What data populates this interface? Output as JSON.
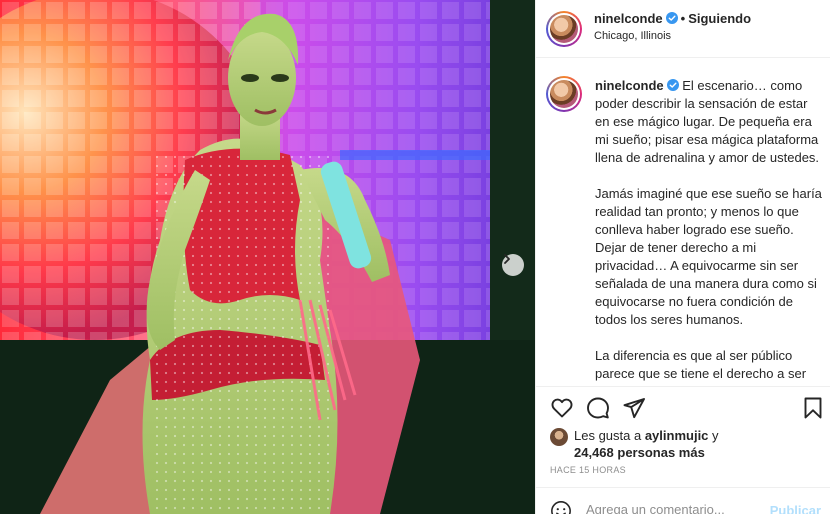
{
  "post": {
    "username": "ninelconde",
    "verified": true,
    "follow_status": "Siguiendo",
    "location": "Chicago, Illinois",
    "caption_paragraphs": [
      "El escenario… como poder describir la sensación de estar en ese mágico lugar. De pequeña era mi sueño; pisar esa mágica plataforma llena de adrenalina y amor de ustedes.",
      "Jamás imaginé que ese sueño se haría realidad tan pronto; y menos lo que conlleva haber logrado ese sueño. Dejar de tener derecho a mi privacidad… A equivocarme sin ser señalada de una manera dura como si equivocarse no fuera condición de todos los seres humanos.",
      "La diferencia es que al ser público parece que se tiene el derecho a ser juzgado incluso en un grado ofensivo, de burla y el invento de historias tipo"
    ],
    "likes_prefix": "Les gusta a ",
    "likes_user": "aylinmujic",
    "likes_middle": " y",
    "likes_count": "24,468 personas más",
    "timestamp": "HACE 15 HORAS",
    "comment_placeholder": "Agrega un comentario...",
    "publish_label": "Publicar"
  },
  "icons": {
    "verified": "verified-badge-icon",
    "like": "heart-icon",
    "comment": "comment-bubble-icon",
    "share": "paper-plane-icon",
    "save": "bookmark-icon",
    "emoji": "smiley-icon",
    "next": "chevron-right-icon"
  },
  "colors": {
    "verified": "#3897f0",
    "publish_disabled": "#b2dffc",
    "muted": "#8e8e8e"
  }
}
